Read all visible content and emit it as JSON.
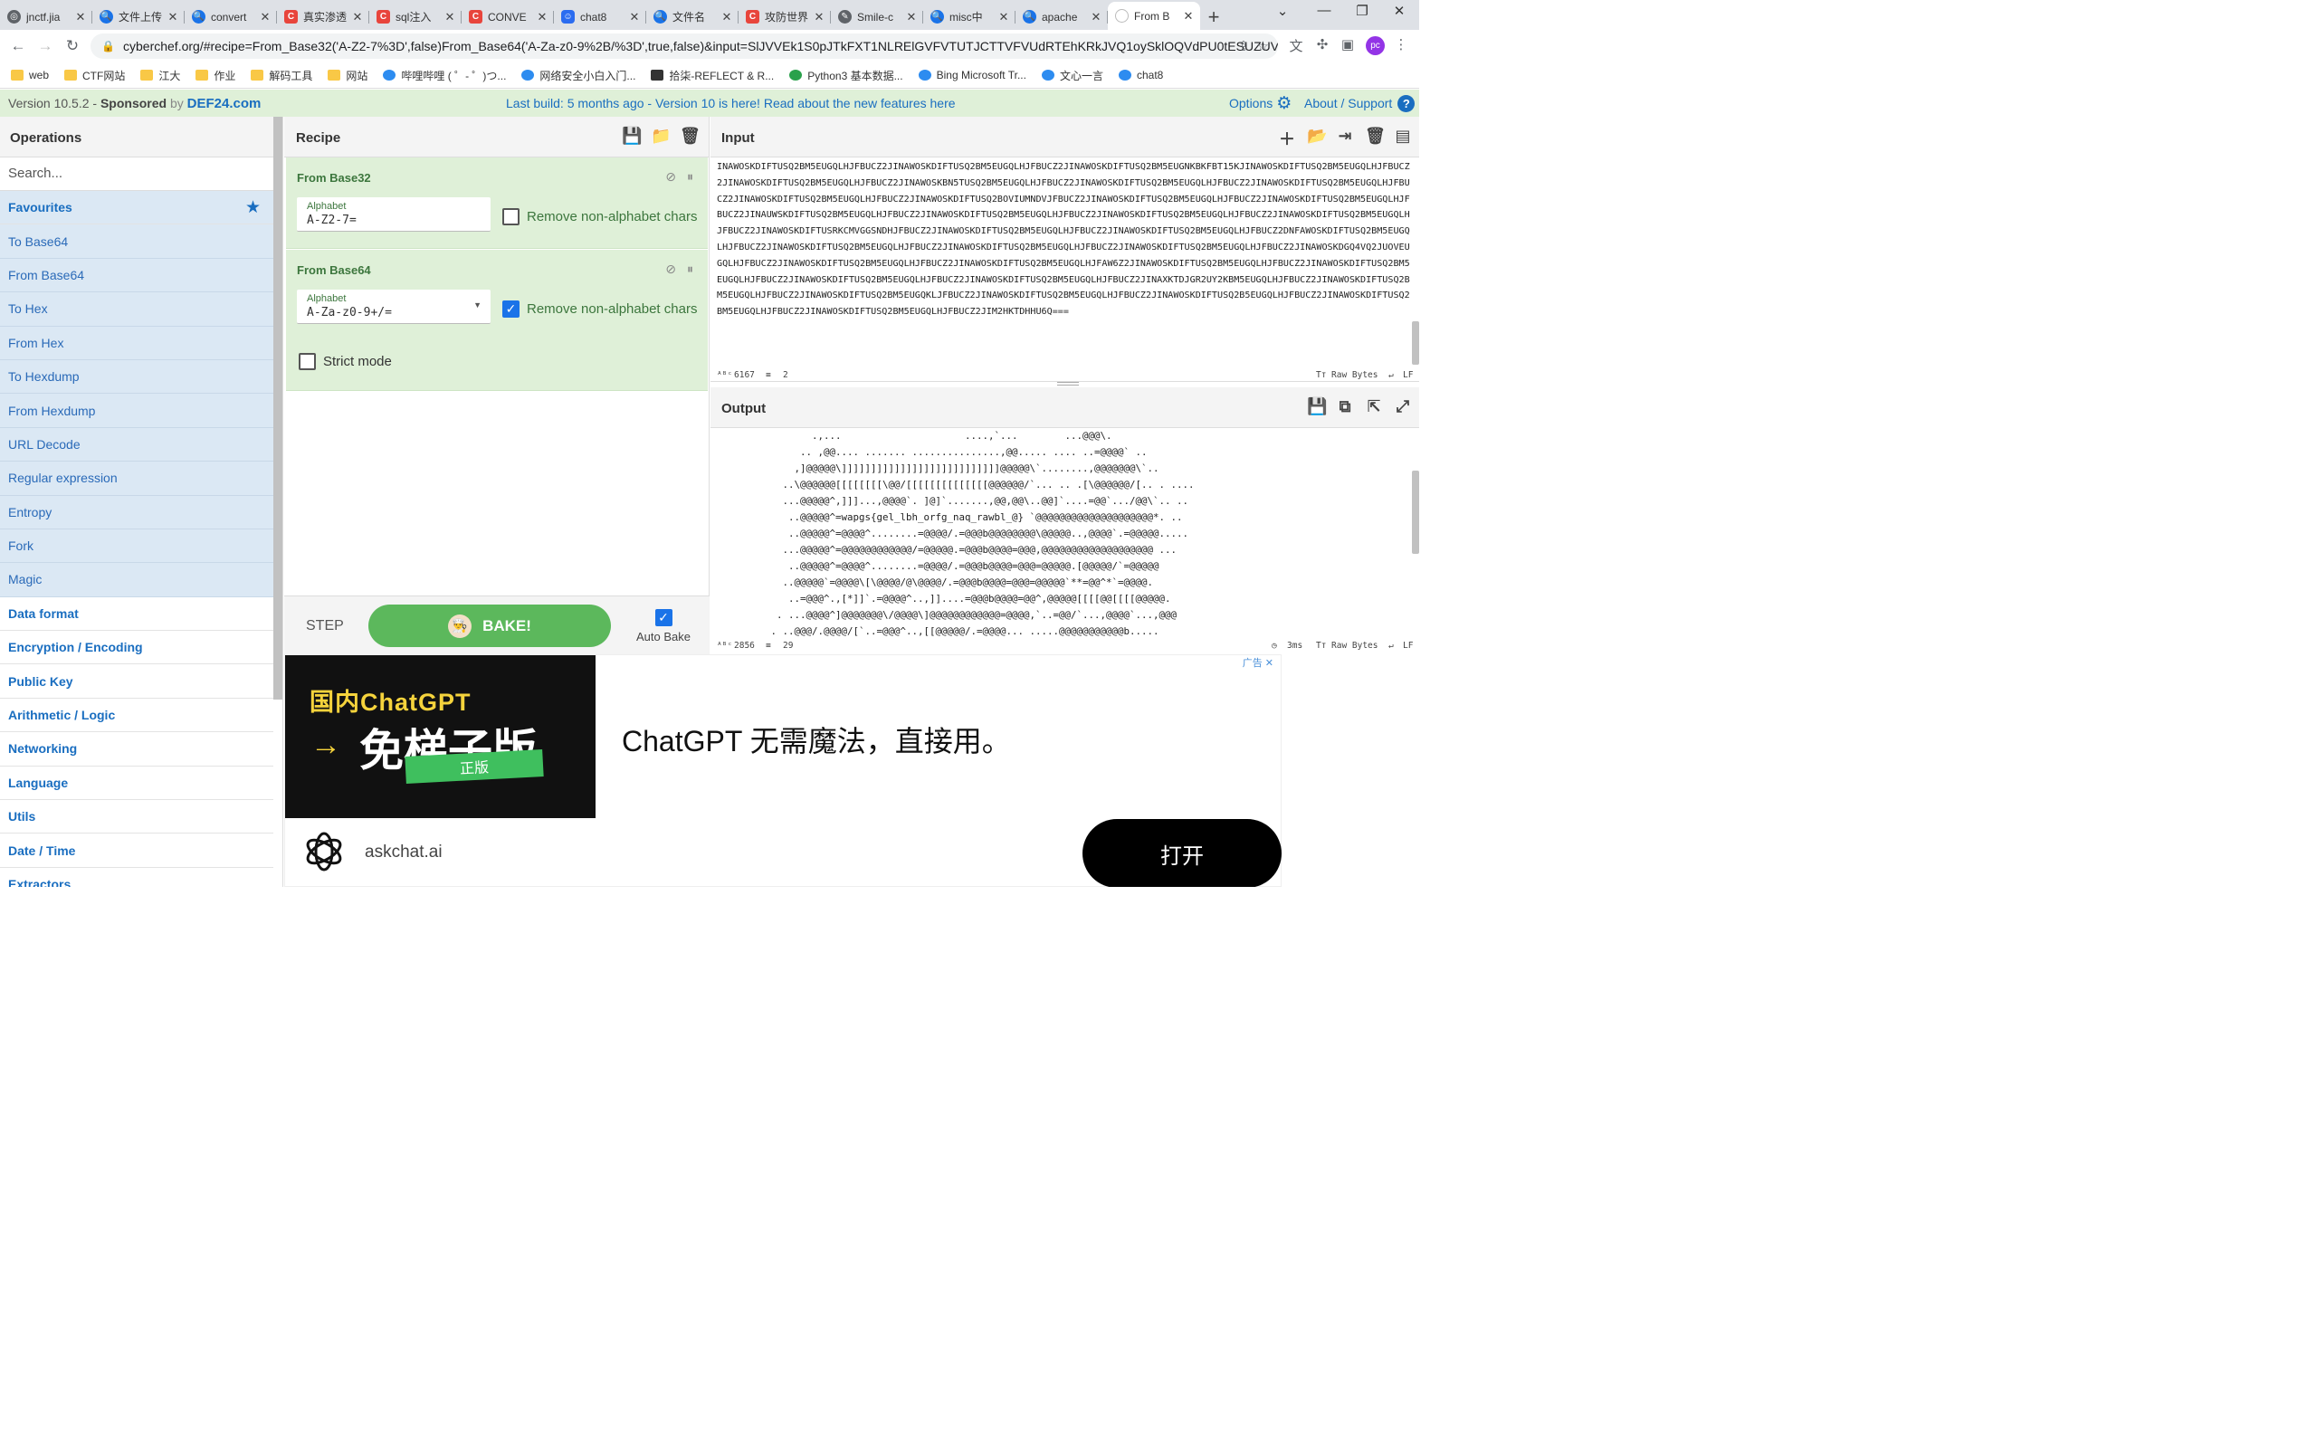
{
  "browser": {
    "tabs": [
      {
        "label": "jnctf.jia",
        "icon": "globe-icon",
        "cls": "g",
        "glyph": "◎"
      },
      {
        "label": "文件上传",
        "icon": "search-icon",
        "cls": "b",
        "glyph": "🔍"
      },
      {
        "label": "convert",
        "icon": "search-icon",
        "cls": "b",
        "glyph": "🔍"
      },
      {
        "label": "真实渗透",
        "icon": "csdn-icon",
        "cls": "r",
        "glyph": "C"
      },
      {
        "label": "sql注入",
        "icon": "csdn-icon",
        "cls": "r",
        "glyph": "C"
      },
      {
        "label": "CONVE",
        "icon": "csdn-icon",
        "cls": "r",
        "glyph": "C"
      },
      {
        "label": "chat8",
        "icon": "chat-icon",
        "cls": "c",
        "glyph": "☺"
      },
      {
        "label": "文件名",
        "icon": "search-icon",
        "cls": "b",
        "glyph": "🔍"
      },
      {
        "label": "攻防世界",
        "icon": "csdn-icon",
        "cls": "r",
        "glyph": "C"
      },
      {
        "label": "Smile-c",
        "icon": "logo-icon",
        "cls": "g",
        "glyph": "✎"
      },
      {
        "label": "misc中",
        "icon": "search-icon",
        "cls": "b",
        "glyph": "🔍"
      },
      {
        "label": "apache",
        "icon": "search-icon",
        "cls": "b",
        "glyph": "🔍"
      },
      {
        "label": "From B",
        "icon": "cyberchef-icon",
        "cls": "w",
        "glyph": ""
      }
    ],
    "url": "cyberchef.org/#recipe=From_Base32('A-Z2-7%3D',false)From_Base64('A-Za-z0-9%2B/%3D',true,false)&input=SlJVVEk1S0pJTkFXT1NLRElGVFVTUTJCTTVFVUdRTEhKRkJVQ1oySklOQVdPU0tESUZUV...",
    "bookmarks": [
      {
        "label": "web",
        "kind": "folder"
      },
      {
        "label": "CTF网站",
        "kind": "folder"
      },
      {
        "label": "江大",
        "kind": "folder"
      },
      {
        "label": "作业",
        "kind": "folder"
      },
      {
        "label": "解码工具",
        "kind": "folder"
      },
      {
        "label": "网站",
        "kind": "folder"
      },
      {
        "label": "哔哩哔哩 ( ゜- ゜)つ...",
        "kind": "blue"
      },
      {
        "label": "网络安全小白入门...",
        "kind": "blue"
      },
      {
        "label": "拾柒-REFLECT & R...",
        "kind": "dark"
      },
      {
        "label": "Python3 基本数据...",
        "kind": "grn"
      },
      {
        "label": "Bing Microsoft Tr...",
        "kind": "blue"
      },
      {
        "label": "文心一言",
        "kind": "blue"
      },
      {
        "label": "chat8",
        "kind": "blue"
      }
    ]
  },
  "banner": {
    "version": "Version 10.5.2 - ",
    "sponsored": "Sponsored",
    "by": " by ",
    "sponsor": "DEF24.com",
    "build": "Last build: 5 months ago - Version 10 is here! Read about the new features here",
    "options": "Options",
    "about": "About / Support"
  },
  "operations": {
    "title": "Operations",
    "search_placeholder": "Search...",
    "favourites": "Favourites",
    "fav_items": [
      "To Base64",
      "From Base64",
      "To Hex",
      "From Hex",
      "To Hexdump",
      "From Hexdump",
      "URL Decode",
      "Regular expression",
      "Entropy",
      "Fork",
      "Magic"
    ],
    "categories": [
      "Data format",
      "Encryption / Encoding",
      "Public Key",
      "Arithmetic / Logic",
      "Networking",
      "Language",
      "Utils",
      "Date / Time",
      "Extractors"
    ]
  },
  "recipe": {
    "title": "Recipe",
    "op1": {
      "name": "From Base32",
      "alphabet_label": "Alphabet",
      "alphabet": "A-Z2-7=",
      "remove_label": "Remove non-alphabet chars",
      "remove": false
    },
    "op2": {
      "name": "From Base64",
      "alphabet_label": "Alphabet",
      "alphabet": "A-Za-z0-9+/=",
      "remove_label": "Remove non-alphabet chars",
      "remove": true,
      "strict_label": "Strict mode",
      "strict": false
    },
    "step": "STEP",
    "bake": "BAKE!",
    "autobake": "Auto Bake",
    "autobake_on": true
  },
  "input": {
    "title": "Input",
    "text": "INAWOSKDIFTUSQ2BM5EUGQLHJFBUCZ2JINAWOSKDIFTUSQ2BM5EUGQLHJFBUCZ2JINAWOSKDIFTUSQ2BM5EUGNKBKFBT15KJINAWOSKDIFTUSQ2BM5EUGQLHJFBUCZ2JINAWOSKDIFTUSQ2BM5EUGQLHJFBUCZ2JINAWOSKBN5TUSQ2BM5EUGQLHJFBUCZ2JINAWOSKDIFTUSQ2BM5EUGQLHJFBUCZ2JINAWOSKDIFTUSQ2BM5EUGQLHJFBUCZ2JINAWOSKDIFTUSQ2BM5EUGQLHJFBUCZ2JINAWOSKDIFTUSQ2BOVIUMNDVJFBUCZ2JINAWOSKDIFTUSQ2BM5EUGQLHJFBUCZ2JINAWOSKDIFTUSQ2BM5EUGQLHJFBUCZ2JINAUWSKDIFTUSQ2BM5EUGQLHJFBUCZ2JINAWOSKDIFTUSQ2BM5EUGQLHJFBUCZ2JINAWOSKDIFTUSQ2BM5EUGQLHJFBUCZ2JINAWOSKDIFTUSQ2BM5EUGQLHJFBUCZ2JINAWOSKDIFTUSRKCMVGGSNDHJFBUCZ2JINAWOSKDIFTUSQ2BM5EUGQLHJFBUCZ2JINAWOSKDIFTUSQ2BM5EUGQLHJFBUCZ2DNFAWOSKDIFTUSQ2BM5EUGQLHJFBUCZ2JINAWOSKDIFTUSQ2BM5EUGQLHJFBUCZ2JINAWOSKDIFTUSQ2BM5EUGQLHJFBUCZ2JINAWOSKDIFTUSQ2BM5EUGQLHJFBUCZ2JINAWOSKDGQ4VQ2JUOVEUGQLHJFBUCZ2JINAWOSKDIFTUSQ2BM5EUGQLHJFBUCZ2JINAWOSKDIFTUSQ2BM5EUGQLHJFAW6Z2JINAWOSKDIFTUSQ2BM5EUGQLHJFBUCZ2JINAWOSKDIFTUSQ2BM5EUGQLHJFBUCZ2JINAWOSKDIFTUSQ2BM5EUGQLHJFBUCZ2JINAWOSKDIFTUSQ2BM5EUGQLHJFBUCZ2JINAXKTDJGR2UY2KBM5EUGQLHJFBUCZ2JINAWOSKDIFTUSQ2BM5EUGQLHJFBUCZ2JINAWOSKDIFTUSQ2BM5EUGQKLJFBUCZ2JINAWOSKDIFTUSQ2BM5EUGQLHJFBUCZ2JINAWOSKDIFTUSQ2B5EUGQLHJFBUCZ2JINAWOSKDIFTUSQ2BM5EUGQLHJFBUCZ2JINAWOSKDIFTUSQ2BM5EUGQLHJFBUCZ2JIM2HKTDHHU6Q===",
    "chars": "6167",
    "lines": "2",
    "encoding": "Raw Bytes",
    "eol": "LF"
  },
  "output": {
    "title": "Output",
    "text": "          .,...                     ....,`...        ...@@@\\.\n        .. ,@@.... ....... ...............,@@..... .... ..=@@@@` ..\n       ,]@@@@@\\]]]]]]]]]]]]]]]]]]]]]]]]]]]@@@@@\\`........,@@@@@@@\\`..\n     ..\\@@@@@@[[[[[[[[\\@@/[[[[[[[[[[[[[[@@@@@@/`... .. .[\\@@@@@@/[.. . ....\n     ...@@@@@^,]]]...,@@@@`. ]@]`.......,@@,@@\\..@@]`....=@@`.../@@\\`.. ..\n      ..@@@@@^=wapgs{gel_lbh_orfg_naq_rawbl_@} `@@@@@@@@@@@@@@@@@@@@*. ..\n      ..@@@@@^=@@@@^........=@@@@/.=@@@b@@@@@@@@\\@@@@@..,@@@@`.=@@@@@.....\n     ...@@@@@^=@@@@@@@@@@@@/=@@@@@.=@@@b@@@@=@@@,@@@@@@@@@@@@@@@@@@@ ...\n      ..@@@@@^=@@@@^........=@@@@/.=@@@b@@@@=@@@=@@@@@.[@@@@@/`=@@@@@\n     ..@@@@@`=@@@@\\[\\@@@@/@\\@@@@/.=@@@b@@@@=@@@=@@@@@`**=@@^*`=@@@@.\n      ..=@@@^.,[*]]`.=@@@@^..,]]....=@@@b@@@@=@@^,@@@@@[[[[@@[[[[@@@@@.\n    . ...@@@@^]@@@@@@@\\/@@@@\\]@@@@@@@@@@@@=@@@@,`..=@@/`...,@@@@`...,@@@\n   . ..@@@/.@@@@/[`..=@@@^..,[[@@@@@/.=@@@@... .....@@@@@@@@@@@b.....",
    "chars": "2856",
    "lines": "29",
    "time": "3ms",
    "encoding": "Raw Bytes",
    "eol": "LF"
  },
  "ad": {
    "label": "广告",
    "brand_line": "国内ChatGPT",
    "arrow": "→",
    "big": "免梯子版",
    "tag": "正版",
    "headline": "ChatGPT 无需魔法，直接用。",
    "domain": "askchat.ai",
    "cta": "打开"
  }
}
